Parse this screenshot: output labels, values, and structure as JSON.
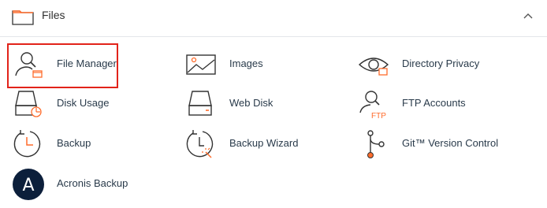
{
  "section": {
    "title": "Files",
    "icon": "folder-icon",
    "collapse_icon": "chevron-up-icon"
  },
  "items": [
    {
      "label": "File Manager",
      "icon": "file-manager-icon",
      "highlighted": true
    },
    {
      "label": "Images",
      "icon": "images-icon"
    },
    {
      "label": "Directory Privacy",
      "icon": "directory-privacy-icon"
    },
    {
      "label": "Disk Usage",
      "icon": "disk-usage-icon"
    },
    {
      "label": "Web Disk",
      "icon": "web-disk-icon"
    },
    {
      "label": "FTP Accounts",
      "icon": "ftp-accounts-icon"
    },
    {
      "label": "Backup",
      "icon": "backup-icon"
    },
    {
      "label": "Backup Wizard",
      "icon": "backup-wizard-icon"
    },
    {
      "label": "Git™ Version Control",
      "icon": "git-icon"
    },
    {
      "label": "Acronis Backup",
      "icon": "acronis-icon"
    }
  ],
  "ftp_icon_text": "FTP",
  "acronis_icon_text": "A",
  "colors": {
    "accent": "#ff6c2c",
    "icon_stroke": "#333333",
    "label": "#293a4a",
    "highlight": "#e2231a",
    "acronis_bg": "#0c1f3b"
  }
}
